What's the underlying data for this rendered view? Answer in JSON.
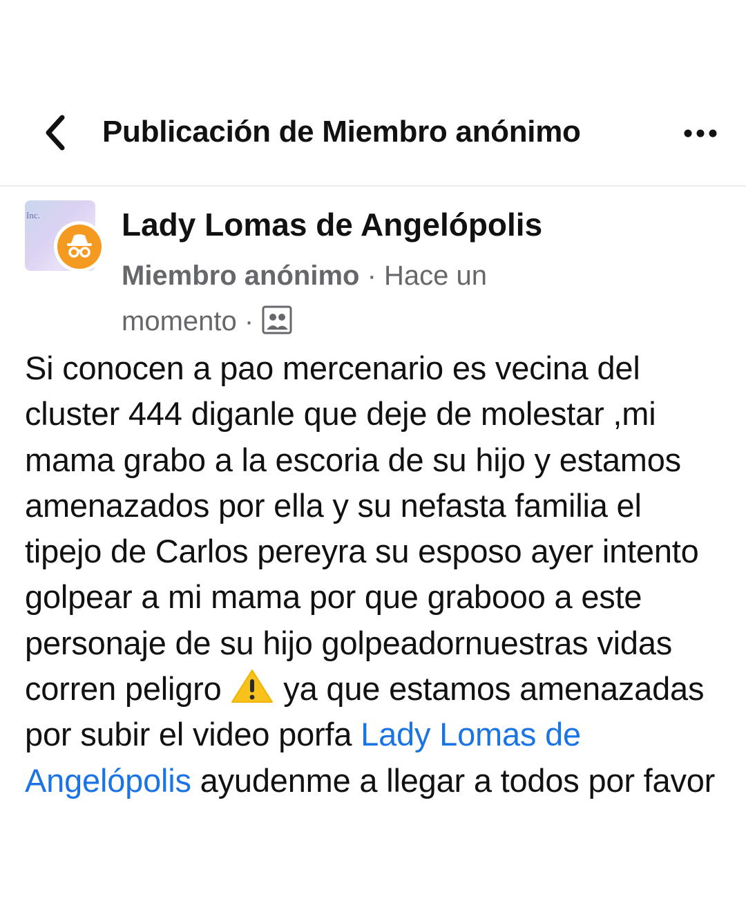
{
  "header": {
    "title": "Publicación de Miembro anónimo",
    "back_icon": "chevron-left-icon",
    "more_icon": "more-horizontal-icon"
  },
  "post": {
    "group_name": "Lady Lomas de Angelópolis",
    "avatar_text": "Inc.",
    "author": "Miembro anónimo",
    "separator": "·",
    "time": "Hace un momento",
    "audience_icon": "group-audience-icon",
    "body": {
      "part1": "Si conocen a pao mercenario es vecina del cluster 444 diganle que deje de molestar ,mi mama grabo a la escoria de su hijo y estamos amenazados  por ella y su nefasta familia el tipejo de Carlos pereyra su esposo ayer intento golpear a mi mama por que grabooo a este personaje de su hijo golpeadornuestras vidas corren peligro",
      "emoji": "warning-emoji",
      "part2": "ya que estamos amenazadas por subir el video porfa",
      "mention": "Lady Lomas de Angelópolis",
      "part3": "ayudenme a llegar a todos por favor"
    }
  },
  "colors": {
    "mention": "#1b74e4",
    "meta": "#65676b",
    "badge": "#f59a21"
  }
}
